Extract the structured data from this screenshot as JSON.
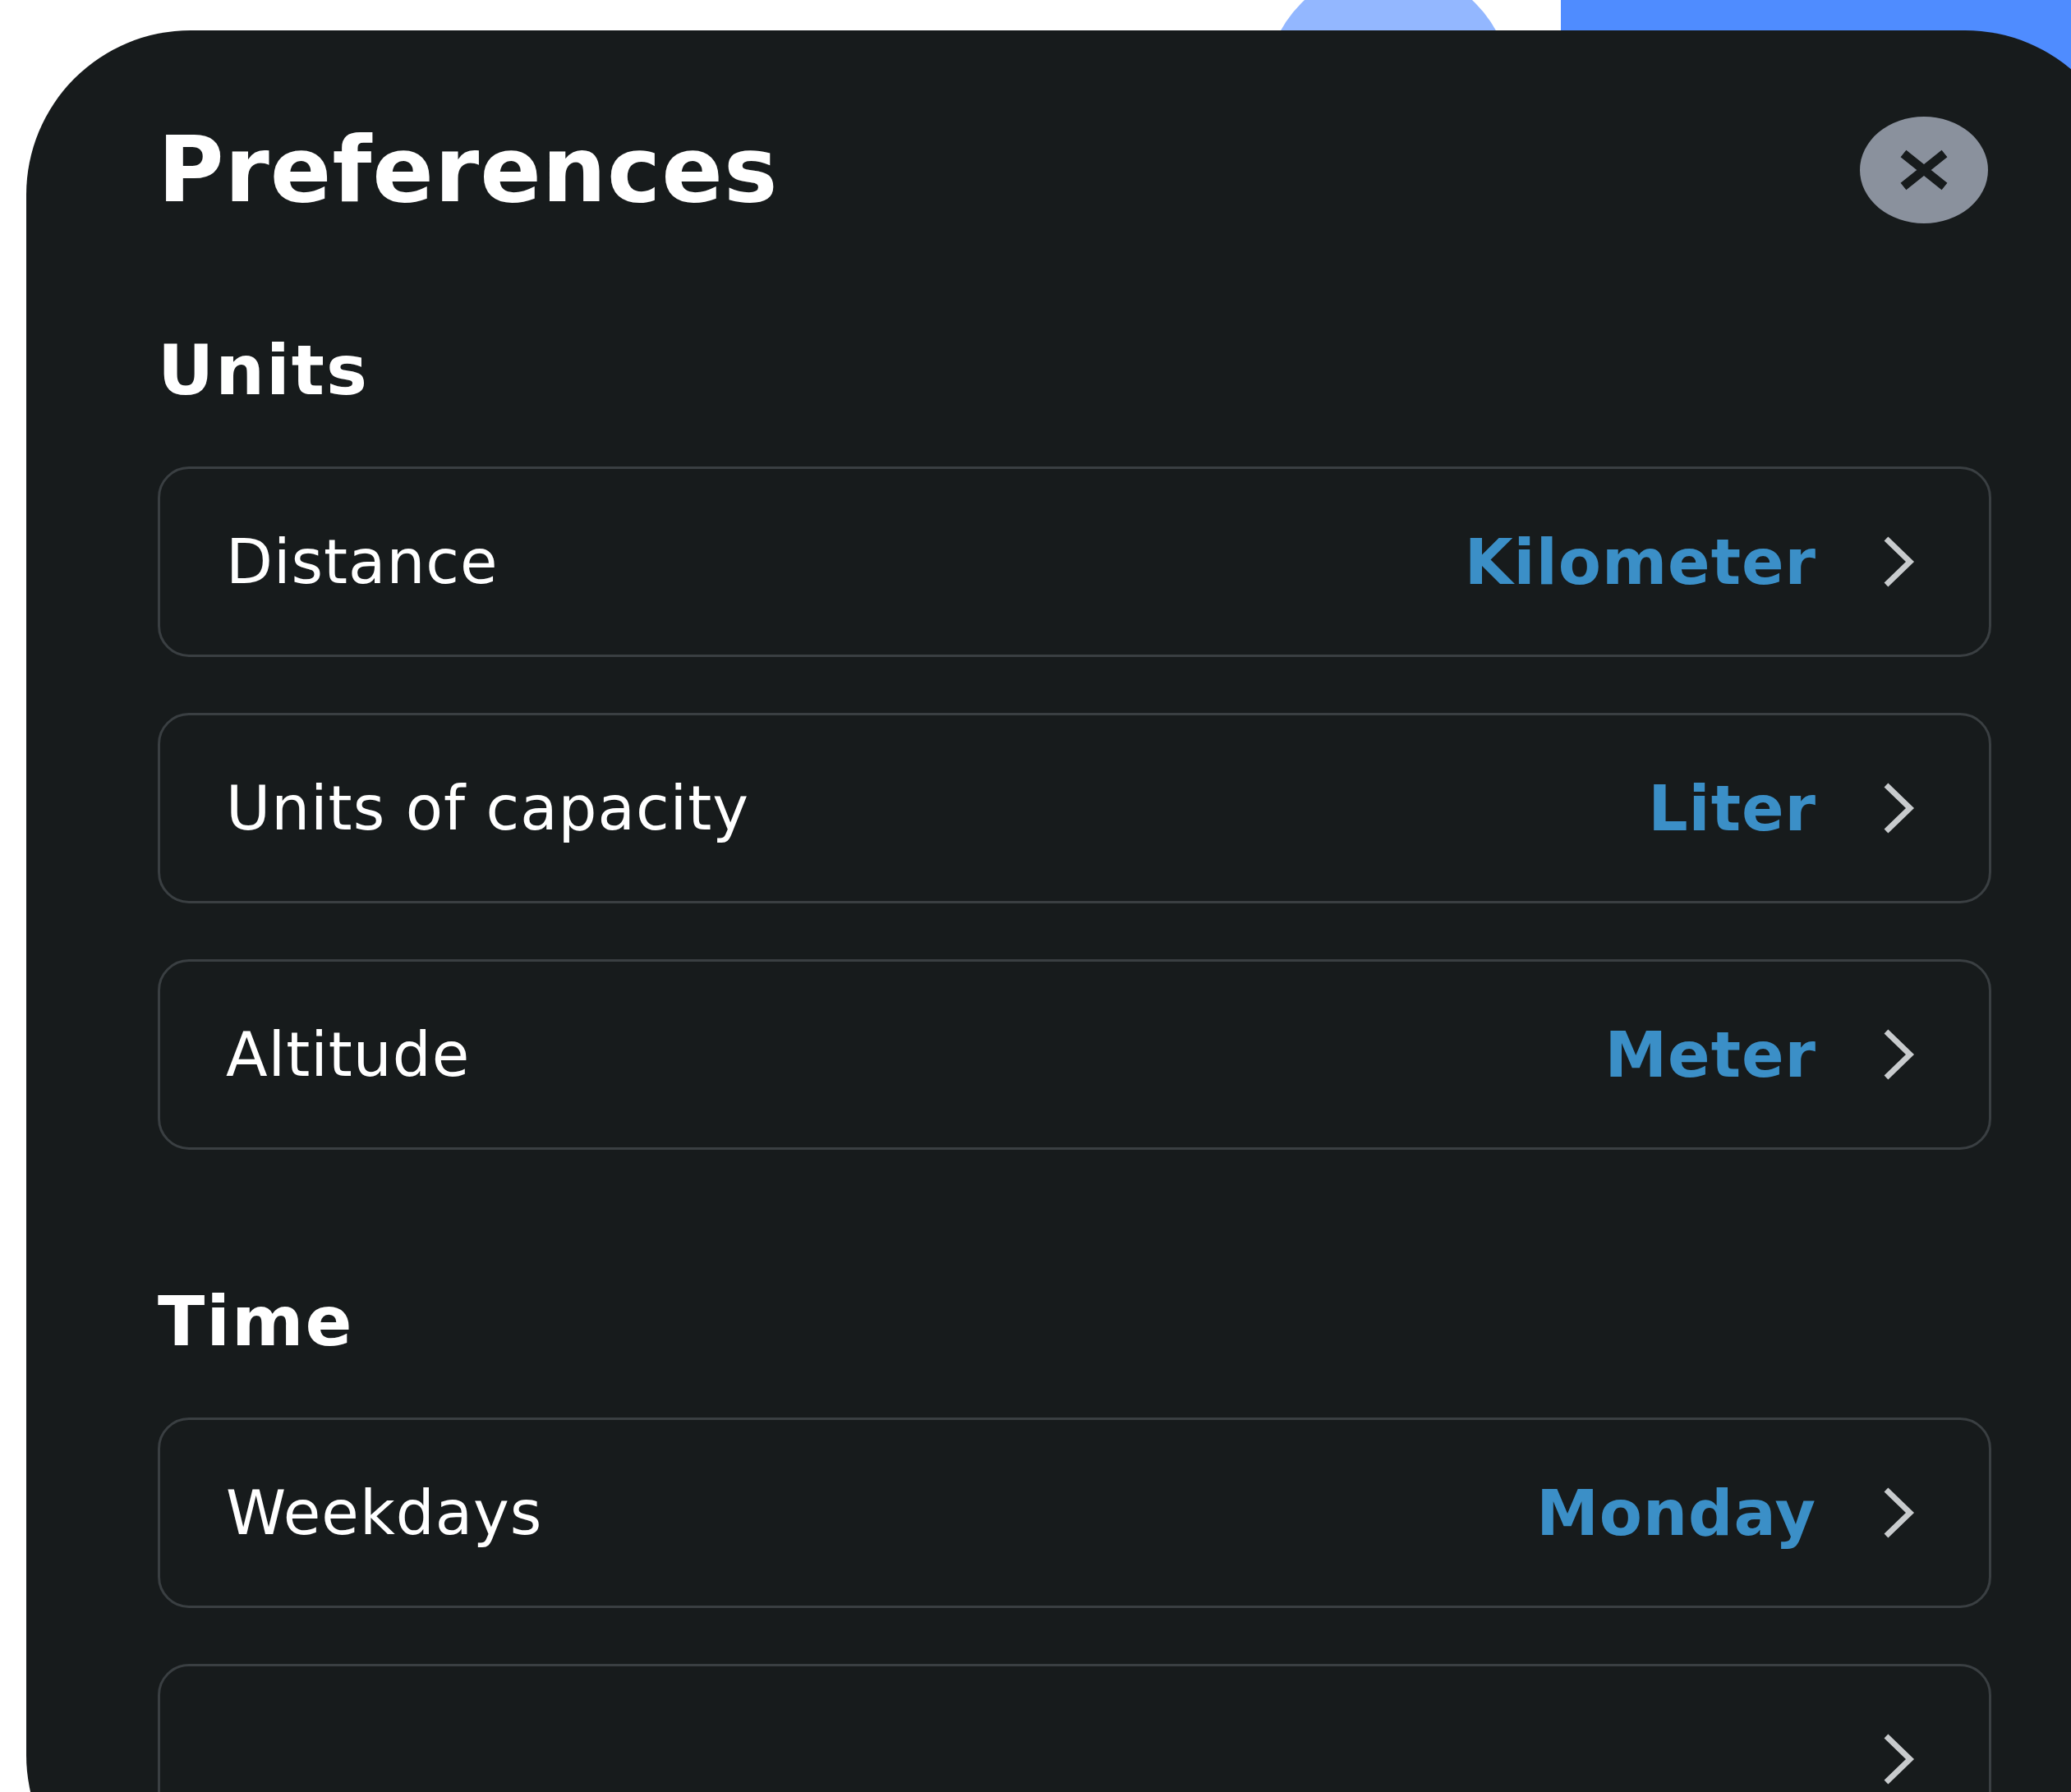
{
  "title": "Preferences",
  "sections": [
    {
      "heading": "Units",
      "rows": [
        {
          "label": "Distance",
          "value": "Kilometer"
        },
        {
          "label": "Units of capacity",
          "value": "Liter"
        },
        {
          "label": "Altitude",
          "value": "Meter"
        }
      ]
    },
    {
      "heading": "Time",
      "rows": [
        {
          "label": "Weekdays",
          "value": "Monday"
        },
        {}
      ]
    }
  ]
}
